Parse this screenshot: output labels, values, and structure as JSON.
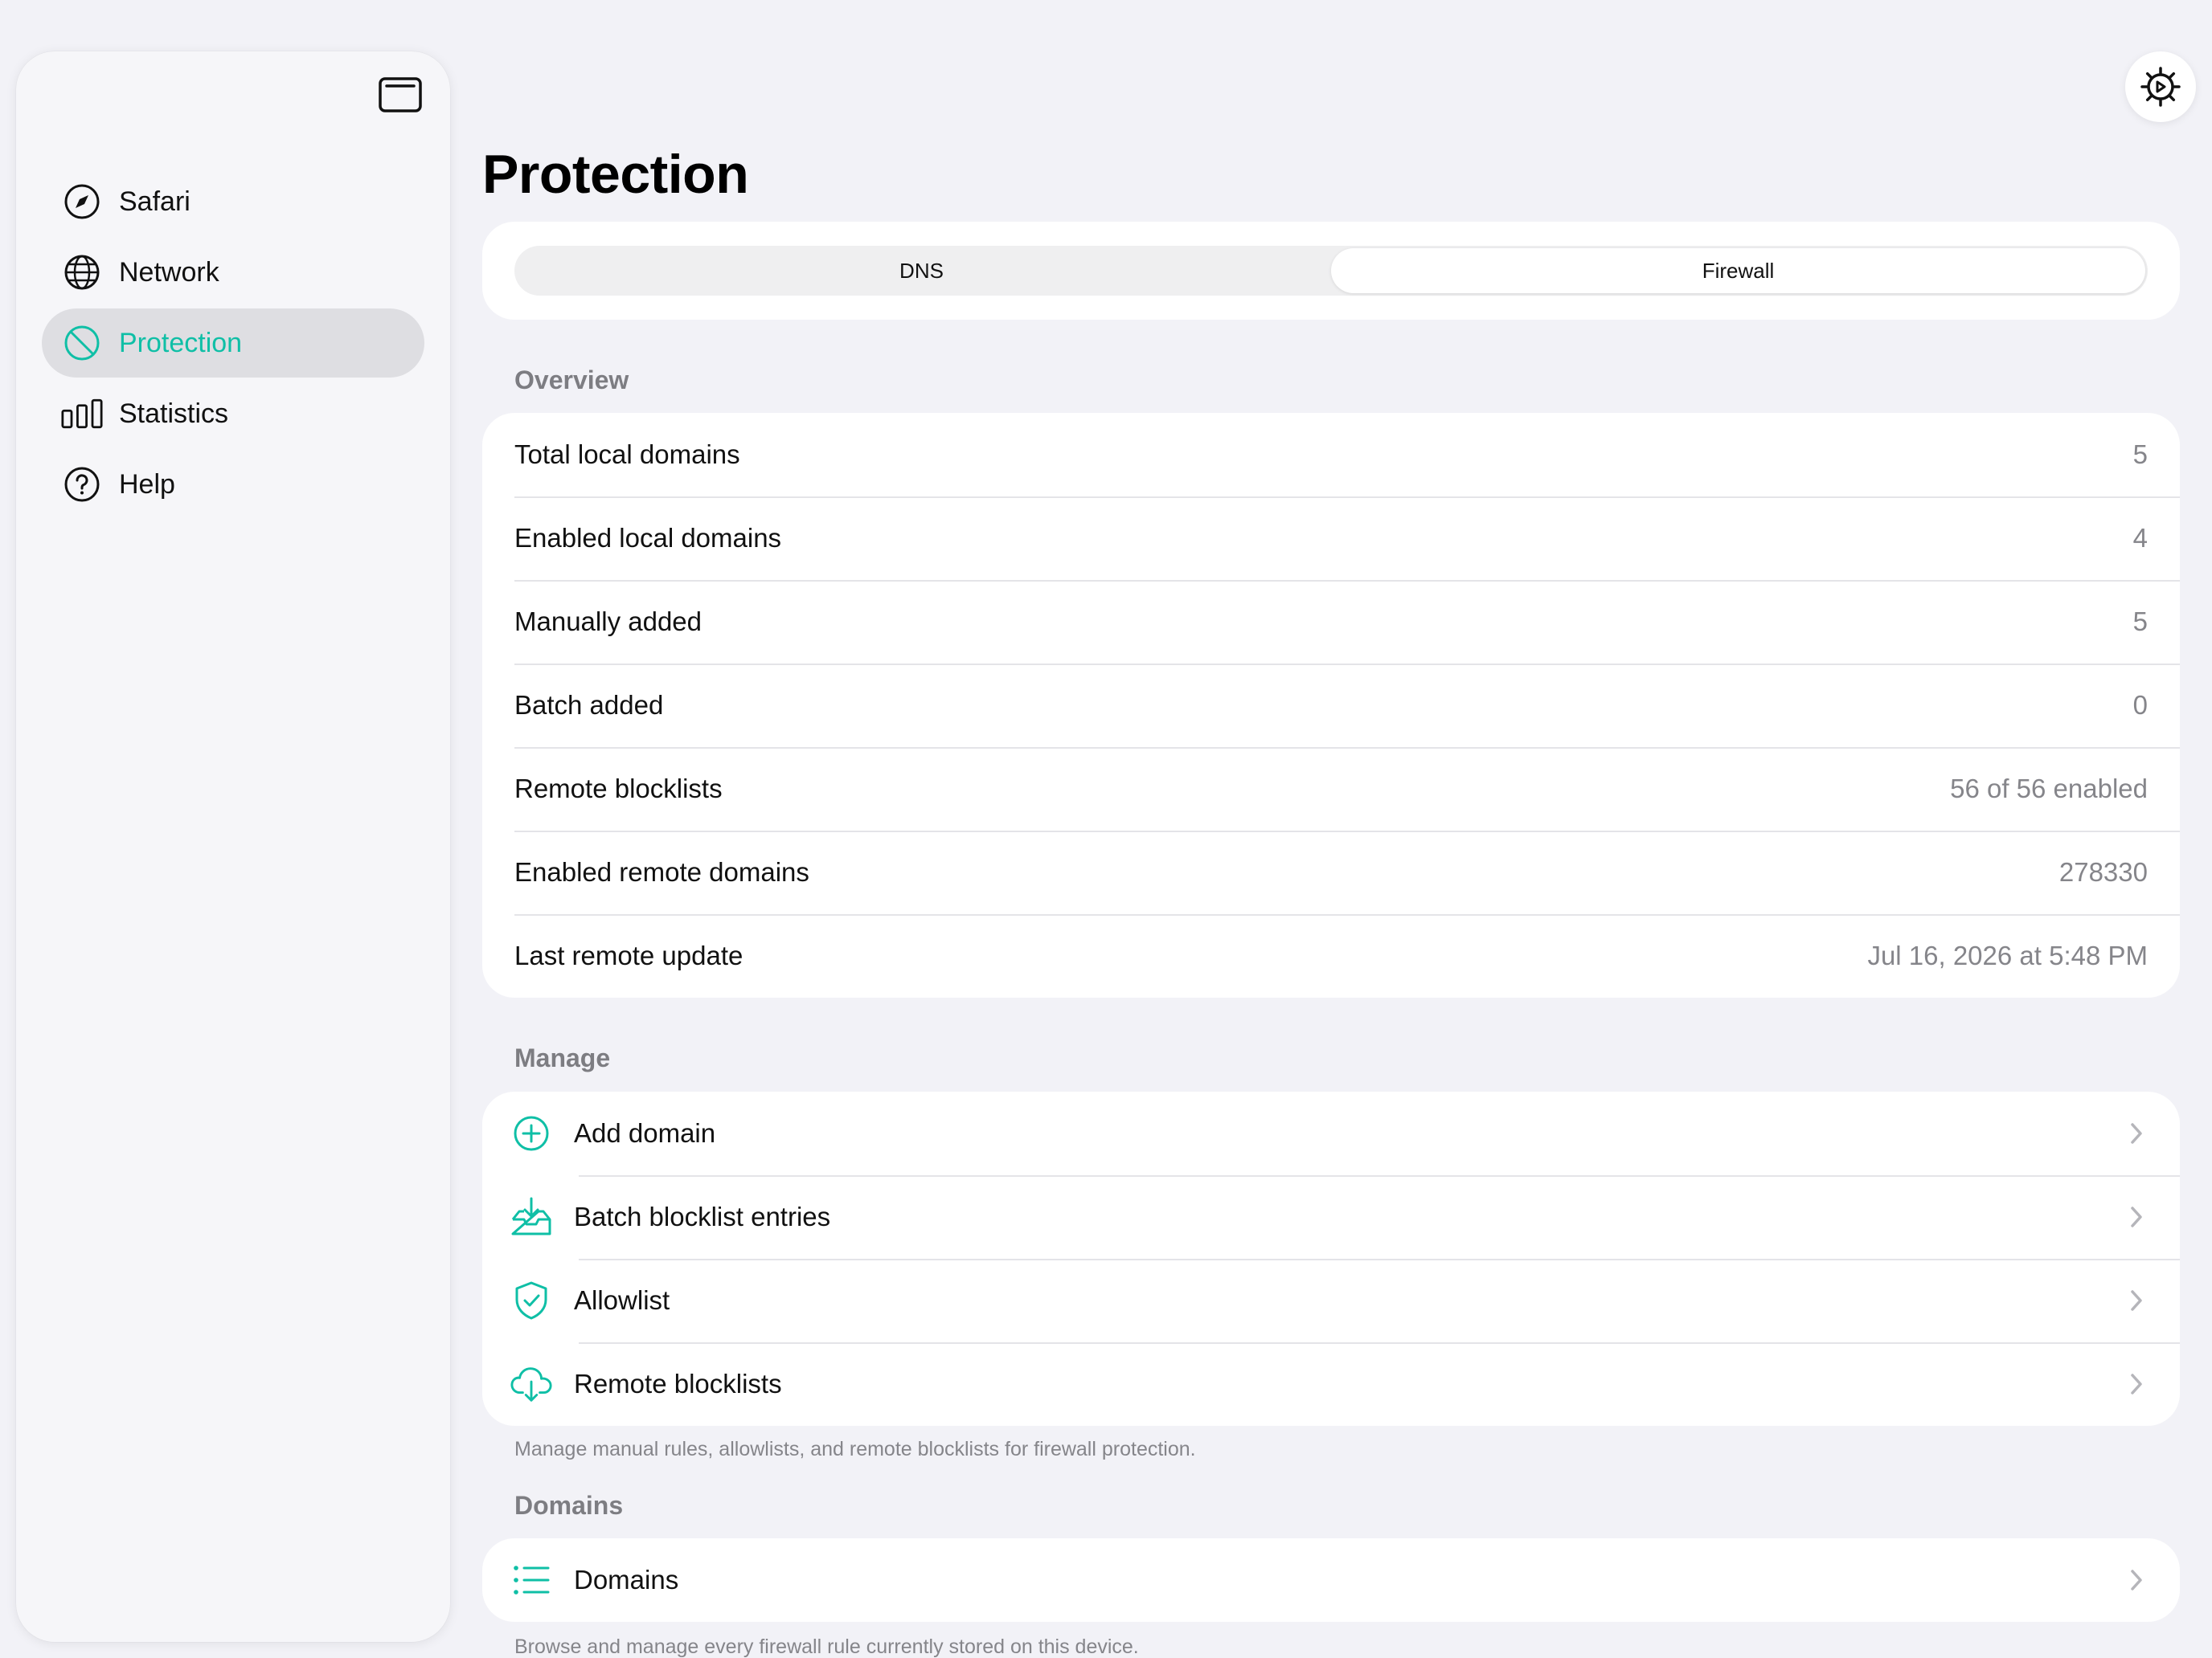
{
  "sidebar": {
    "items": [
      {
        "label": "Safari",
        "icon": "compass-icon",
        "active": false
      },
      {
        "label": "Network",
        "icon": "globe-icon",
        "active": false
      },
      {
        "label": "Protection",
        "icon": "prohibited-icon",
        "active": true
      },
      {
        "label": "Statistics",
        "icon": "bar-chart-icon",
        "active": false
      },
      {
        "label": "Help",
        "icon": "question-circle-icon",
        "active": false
      }
    ]
  },
  "page": {
    "title": "Protection"
  },
  "segmented": {
    "options": [
      "DNS",
      "Firewall"
    ],
    "selected": "Firewall"
  },
  "overview": {
    "header": "Overview",
    "rows": [
      {
        "label": "Total local domains",
        "value": "5"
      },
      {
        "label": "Enabled local domains",
        "value": "4"
      },
      {
        "label": "Manually added",
        "value": "5"
      },
      {
        "label": "Batch added",
        "value": "0"
      },
      {
        "label": "Remote blocklists",
        "value": "56 of 56 enabled"
      },
      {
        "label": "Enabled remote domains",
        "value": "278330"
      },
      {
        "label": "Last remote update",
        "value": "Jul 16, 2026 at 5:48 PM"
      }
    ]
  },
  "manage": {
    "header": "Manage",
    "rows": [
      {
        "label": "Add domain",
        "icon": "plus-circle-icon"
      },
      {
        "label": "Batch blocklist entries",
        "icon": "tray-download-icon"
      },
      {
        "label": "Allowlist",
        "icon": "shield-check-icon"
      },
      {
        "label": "Remote blocklists",
        "icon": "cloud-download-icon"
      }
    ],
    "footer": "Manage manual rules, allowlists, and remote blocklists for firewall protection."
  },
  "domains": {
    "header": "Domains",
    "rows": [
      {
        "label": "Domains",
        "icon": "list-icon"
      }
    ],
    "footer": "Browse and manage every firewall rule currently stored on this device."
  },
  "colors": {
    "accent": "#0fbfa6",
    "background": "#f2f2f7",
    "secondary_text": "#85858a"
  }
}
